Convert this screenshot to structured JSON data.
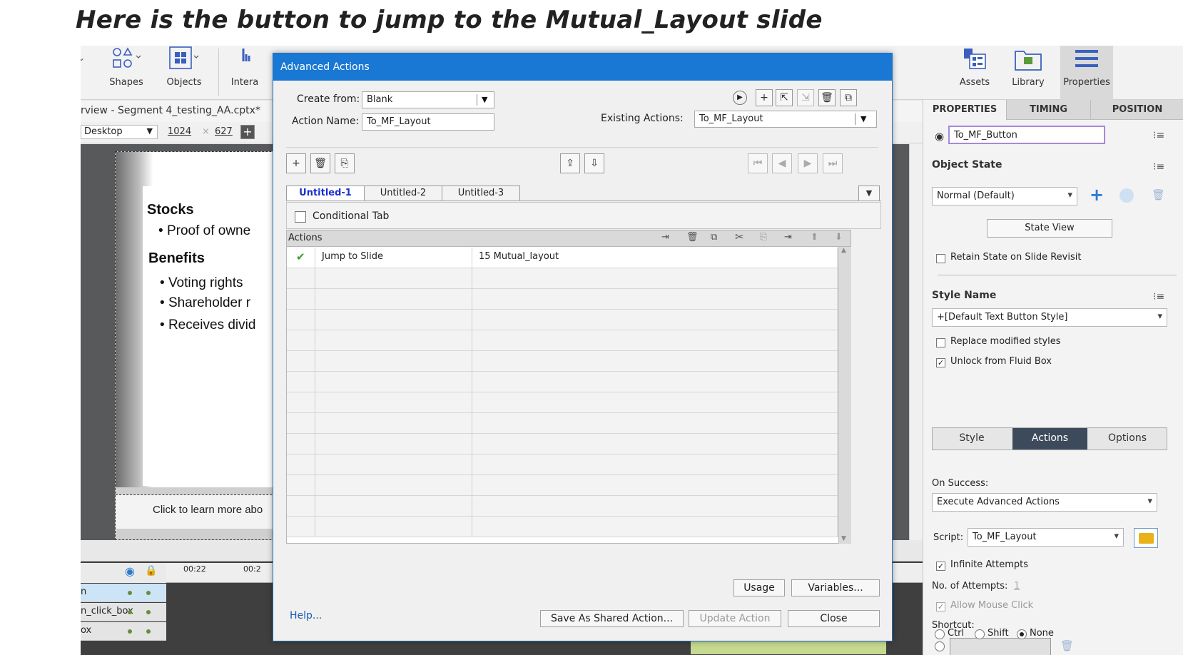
{
  "caption": "Here is the button to jump to the Mutual_Layout slide",
  "toolbar": {
    "shapes": "Shapes",
    "objects": "Objects",
    "interactions": "Intera",
    "assets": "Assets",
    "library": "Library",
    "properties": "Properties"
  },
  "document": {
    "tab_title": "rview - Segment 4_testing_AA.cptx*",
    "view_mode": "Desktop",
    "width": "1024",
    "height": "627"
  },
  "slide": {
    "heading1": "Stocks",
    "bullet1": "Proof of owne",
    "heading2": "Benefits",
    "bullets": [
      "Voting rights",
      "Shareholder r",
      "Receives divid"
    ],
    "button_text": "Click to learn more abo"
  },
  "timeline": {
    "time1": "00:22",
    "time2": "00:2",
    "rows": [
      "n",
      "n_click_box",
      "ox"
    ]
  },
  "dialog": {
    "title": "Advanced Actions",
    "create_from_label": "Create from:",
    "create_from_value": "Blank",
    "action_name_label": "Action Name:",
    "action_name_value": "To_MF_Layout",
    "existing_actions_label": "Existing Actions:",
    "existing_actions_value": "To_MF_Layout",
    "tabs": [
      "Untitled-1",
      "Untitled-2",
      "Untitled-3"
    ],
    "conditional_tab_label": "Conditional Tab",
    "actions_header": "Actions",
    "actions": [
      {
        "action": "Jump to Slide",
        "target": "15 Mutual_layout"
      }
    ],
    "usage": "Usage",
    "variables": "Variables...",
    "help": "Help...",
    "save_shared": "Save As Shared Action...",
    "update": "Update Action",
    "close": "Close"
  },
  "properties": {
    "tabs": [
      "PROPERTIES",
      "TIMING",
      "POSITION"
    ],
    "object_name": "To_MF_Button",
    "object_state_title": "Object State",
    "state_value": "Normal (Default)",
    "state_view": "State View",
    "retain_state": "Retain State on Slide Revisit",
    "style_name_title": "Style Name",
    "style_value": "+[Default Text Button Style]",
    "replace_styles": "Replace modified styles",
    "unlock_fluid": "Unlock from Fluid Box",
    "segments": [
      "Style",
      "Actions",
      "Options"
    ],
    "on_success_label": "On Success:",
    "on_success_value": "Execute Advanced Actions",
    "script_label": "Script:",
    "script_value": "To_MF_Layout",
    "infinite_attempts": "Infinite Attempts",
    "attempts_label": "No. of Attempts:",
    "attempts_value": "1",
    "allow_mouse_click": "Allow Mouse Click",
    "shortcut_label": "Shortcut:",
    "ctrl": "Ctrl",
    "shift": "Shift",
    "none": "None"
  },
  "colors": {
    "dialog_title_bar": "#1978d4",
    "active_segment": "#3d4a5c",
    "active_tab_text": "#1a2fd0",
    "check_green": "#3a9a2a"
  }
}
